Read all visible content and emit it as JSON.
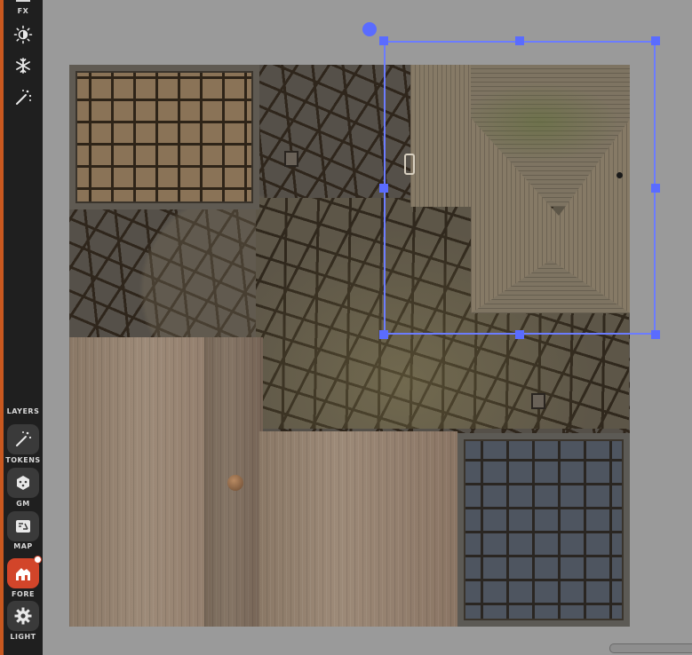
{
  "toolbar": {
    "fx_label": "FX",
    "tools": [
      {
        "name": "light-tool",
        "icon": "sun-half-icon"
      },
      {
        "name": "snow-tool",
        "icon": "snowflake-icon"
      },
      {
        "name": "magic-tool",
        "icon": "magic-wand-icon"
      }
    ],
    "layers_label": "LAYERS",
    "layers": [
      {
        "label": "TOKENS",
        "icon": "magic-wand-icon",
        "active": false
      },
      {
        "label": "GM",
        "icon": "dice-icon",
        "active": false
      },
      {
        "label": "MAP",
        "icon": "map-icon",
        "active": false
      },
      {
        "label": "FORE",
        "icon": "buildings-icon",
        "active": true
      },
      {
        "label": "LIGHT",
        "icon": "gear-icon",
        "active": false
      }
    ]
  },
  "colors": {
    "selection": "#6b7cff",
    "active_layer": "#d2452a",
    "toolbar_bg": "#1f1f1f",
    "canvas_bg": "#9a9a9a"
  }
}
